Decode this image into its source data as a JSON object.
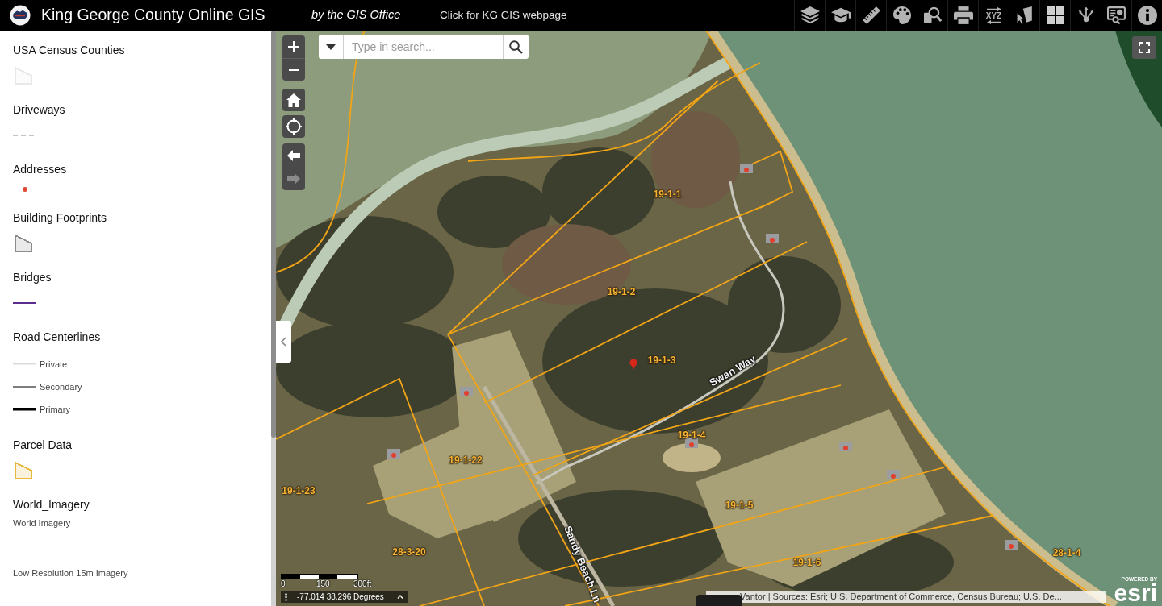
{
  "header": {
    "title": "King George County Online GIS",
    "subtitle": "by the GIS Office",
    "link": "Click for KG GIS webpage",
    "tools": [
      {
        "kind": "layers"
      },
      {
        "kind": "learn"
      },
      {
        "kind": "measure"
      },
      {
        "kind": "draw"
      },
      {
        "kind": "query"
      },
      {
        "kind": "print"
      },
      {
        "kind": "coordinates",
        "label": "XYZ"
      },
      {
        "kind": "select"
      },
      {
        "kind": "basemaps"
      },
      {
        "kind": "share"
      },
      {
        "kind": "report"
      },
      {
        "kind": "about"
      }
    ]
  },
  "legend": {
    "layers": [
      {
        "title": "USA Census Counties",
        "symbols": [
          {
            "kind": "polygon",
            "color": "#e8e8e8"
          }
        ]
      },
      {
        "title": "Driveways",
        "symbols": [
          {
            "kind": "dashed",
            "color": "#c4c4c4"
          }
        ]
      },
      {
        "title": "Addresses",
        "symbols": [
          {
            "kind": "dot",
            "color": "#e04a35"
          }
        ]
      },
      {
        "title": "Building Footprints",
        "symbols": [
          {
            "kind": "polygon",
            "color": "#8c8c8c"
          }
        ]
      },
      {
        "title": "Bridges",
        "symbols": [
          {
            "kind": "line",
            "color": "#5b2d8e"
          }
        ]
      },
      {
        "title": "Road Centerlines",
        "symbols": [
          {
            "kind": "hairline",
            "color": "#dadada",
            "label": "Private"
          },
          {
            "kind": "line",
            "color": "#7d7d7d",
            "label": "Secondary"
          },
          {
            "kind": "boldline",
            "color": "#000000",
            "label": "Primary"
          }
        ]
      },
      {
        "title": "Parcel Data",
        "symbols": [
          {
            "kind": "polygon",
            "color": "#e6b93c"
          }
        ]
      },
      {
        "title": "World_Imagery",
        "symbols": [
          {
            "kind": "note",
            "label": "World Imagery"
          },
          {
            "kind": "note",
            "label": "Low Resolution 15m Imagery"
          }
        ]
      }
    ]
  },
  "map": {
    "search": {
      "placeholder": "Type in search..."
    },
    "navigation": [
      {
        "kind": "back",
        "disabled": false
      },
      {
        "kind": "forward",
        "disabled": true
      }
    ],
    "labels": [
      {
        "kind": "parcel",
        "text": "19-1-1"
      },
      {
        "kind": "parcel",
        "text": "19-1-2"
      },
      {
        "kind": "parcel",
        "text": "19-1-3"
      },
      {
        "kind": "road",
        "text": "Swan Way"
      },
      {
        "kind": "parcel",
        "text": "19-1-4"
      },
      {
        "kind": "parcel",
        "text": "19-1-22"
      },
      {
        "kind": "parcel",
        "text": "19-1-23"
      },
      {
        "kind": "parcel",
        "text": "19-1-5"
      },
      {
        "kind": "parcel",
        "text": "28-1-4"
      },
      {
        "kind": "parcel",
        "text": "28-3-20"
      },
      {
        "kind": "parcel",
        "text": "19-1-6"
      },
      {
        "kind": "road",
        "text": "Sandy Beach Ln"
      }
    ],
    "scale": [
      "0",
      "150",
      "300ft"
    ],
    "coordinates": "-77.014 38.296 Degrees",
    "attribution": "Vantor | Sources: Esri; U.S. Department of Commerce, Census Bureau; U.S. De...",
    "logo": {
      "caption": "POWERED BY",
      "brand": "esri"
    }
  }
}
